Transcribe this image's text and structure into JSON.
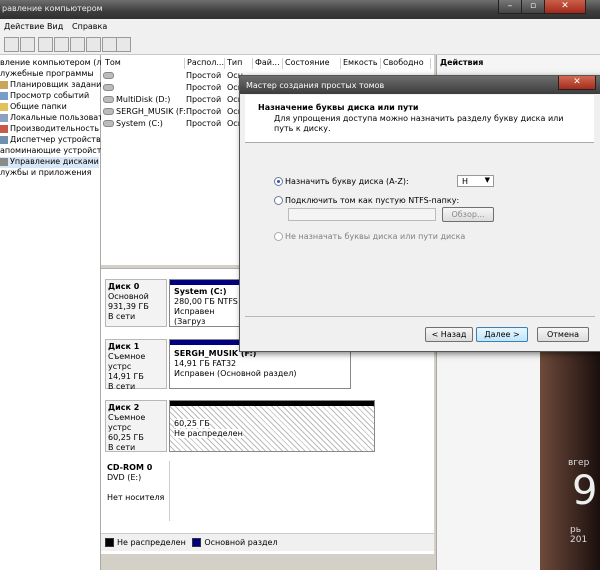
{
  "window": {
    "title": "равление компьютером"
  },
  "menu": [
    "Действие",
    "Вид",
    "Справка"
  ],
  "tree": [
    "вление компьютером (ло",
    "лужебные программы",
    "Планировщик заданий",
    "Просмотр событий",
    "Общие папки",
    "Локальные пользовате",
    "Производительность",
    "Диспетчер устройств",
    "апоминающие устройств",
    "Управление дисками",
    "лужбы и приложения"
  ],
  "columns": [
    "Том",
    "Распол...",
    "Тип",
    "Фай...",
    "Состояние",
    "Емкость",
    "Свободно"
  ],
  "volumes": [
    {
      "name": "",
      "layout": "Простой",
      "type": "Осн"
    },
    {
      "name": "",
      "layout": "Простой",
      "type": "Осн"
    },
    {
      "name": "MultiDisk (D:)",
      "layout": "Простой",
      "type": "Осн"
    },
    {
      "name": "SERGH_MUSIK (F:)",
      "layout": "Простой",
      "type": "Осн"
    },
    {
      "name": "System (C:)",
      "layout": "Простой",
      "type": "Осн"
    }
  ],
  "actions": {
    "header": "Действия"
  },
  "disks": [
    {
      "name": "Диск 0",
      "kind": "Основной",
      "size": "931,39 ГБ",
      "state": "В сети",
      "part": {
        "name": "System  (C:)",
        "size": "280,00 ГБ NTFS",
        "status": "Исправен (Загруз"
      }
    },
    {
      "name": "Диск 1",
      "kind": "Съемное устрс",
      "size": "14,91 ГБ",
      "state": "В сети",
      "part": {
        "name": "SERGH_MUSIK  (F:)",
        "size": "14,91 ГБ FAT32",
        "status": "Исправен (Основной раздел)"
      }
    },
    {
      "name": "Диск 2",
      "kind": "Съемное устрс",
      "size": "60,25 ГБ",
      "state": "В сети",
      "part": {
        "name": "",
        "size": "60,25 ГБ",
        "status": "Не распределен"
      }
    },
    {
      "name": "CD-ROM 0",
      "kind": "DVD (E:)",
      "size": "",
      "state": "Нет носителя"
    }
  ],
  "legend": [
    "Не распределен",
    "Основной раздел"
  ],
  "wizard": {
    "title": "Мастер создания простых томов",
    "heading": "Назначение буквы диска или пути",
    "subheading": "Для упрощения доступа можно назначить разделу букву диска или путь к диску.",
    "opt_letter": "Назначить букву диска (A-Z):",
    "letter_value": "H",
    "opt_folder": "Подключить том как пустую NTFS-папку:",
    "browse": "Обзор...",
    "opt_none": "Не назначать буквы диска или пути диска",
    "back": "< Назад",
    "next": "Далее >",
    "cancel": "Отмена"
  },
  "wallpaper": {
    "day": "вгер",
    "month": "рь 201",
    "digit": "9"
  },
  "colors": {
    "unallocated": "#000000",
    "primary": "#00007f",
    "title_dark": "#3c3c3c"
  }
}
